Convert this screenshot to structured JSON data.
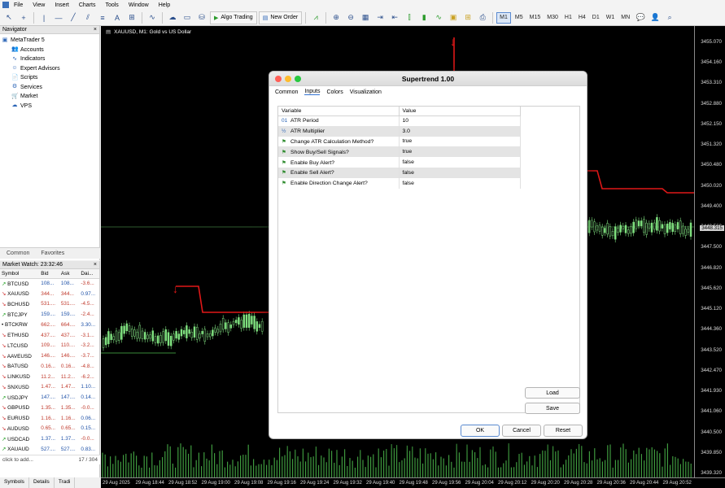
{
  "menu": [
    "File",
    "View",
    "Insert",
    "Charts",
    "Tools",
    "Window",
    "Help"
  ],
  "toolbar": {
    "algo_trading": "Algo Trading",
    "new_order": "New Order",
    "timeframes": [
      "M1",
      "M5",
      "M15",
      "M30",
      "H1",
      "H4",
      "D1",
      "W1",
      "MN"
    ],
    "active_timeframe": "M1"
  },
  "navigator": {
    "title": "Navigator",
    "root": "MetaTrader 5",
    "items": [
      "Accounts",
      "Indicators",
      "Expert Advisors",
      "Scripts",
      "Services",
      "Market",
      "VPS"
    ],
    "tabs": [
      "Common",
      "Favorites"
    ]
  },
  "market_watch": {
    "title": "Market Watch: 23:32:46",
    "columns": [
      "Symbol",
      "Bid",
      "Ask",
      "Dai..."
    ],
    "rows": [
      {
        "symbol": "BTCUSD",
        "bid": "108...",
        "ask": "108...",
        "daily": "-3.6...",
        "dir": "up"
      },
      {
        "symbol": "XAUUSD",
        "bid": "344...",
        "ask": "344...",
        "daily": "0.97...",
        "dir": "dn"
      },
      {
        "symbol": "BCHUSD",
        "bid": "531....",
        "ask": "531....",
        "daily": "-4.5...",
        "dir": "dn"
      },
      {
        "symbol": "BTCJPY",
        "bid": "159....",
        "ask": "159....",
        "daily": "-2.4...",
        "dir": "up"
      },
      {
        "symbol": "BTCKRW",
        "bid": "662....",
        "ask": "664....",
        "daily": "3.30...",
        "dir": "flat"
      },
      {
        "symbol": "ETHUSD",
        "bid": "437....",
        "ask": "437....",
        "daily": "-3.1...",
        "dir": "dn"
      },
      {
        "symbol": "LTCUSD",
        "bid": "109....",
        "ask": "110....",
        "daily": "-3.2...",
        "dir": "dn"
      },
      {
        "symbol": "AAVEUSD",
        "bid": "146....",
        "ask": "146....",
        "daily": "-3.7...",
        "dir": "dn"
      },
      {
        "symbol": "BATUSD",
        "bid": "0.16...",
        "ask": "0.16...",
        "daily": "-4.8...",
        "dir": "dn"
      },
      {
        "symbol": "LINKUSD",
        "bid": "11.2...",
        "ask": "11.2...",
        "daily": "-6.2...",
        "dir": "dn"
      },
      {
        "symbol": "SNXUSD",
        "bid": "1.47...",
        "ask": "1.47...",
        "daily": "1.10...",
        "dir": "dn"
      },
      {
        "symbol": "USDJPY",
        "bid": "147....",
        "ask": "147....",
        "daily": "0.14...",
        "dir": "up"
      },
      {
        "symbol": "GBPUSD",
        "bid": "1.35...",
        "ask": "1.35...",
        "daily": "-0.0...",
        "dir": "dn"
      },
      {
        "symbol": "EURUSD",
        "bid": "1.16...",
        "ask": "1.16...",
        "daily": "0.06...",
        "dir": "dn"
      },
      {
        "symbol": "AUDUSD",
        "bid": "0.65...",
        "ask": "0.65...",
        "daily": "0.15...",
        "dir": "dn"
      },
      {
        "symbol": "USDCAD",
        "bid": "1.37...",
        "ask": "1.37...",
        "daily": "-0.0...",
        "dir": "up"
      },
      {
        "symbol": "XAUAUD",
        "bid": "527....",
        "ask": "527....",
        "daily": "0.83...",
        "dir": "up"
      }
    ],
    "add_hint": "click to add...",
    "count": "17 / 304"
  },
  "bottom_tabs": [
    "Symbols",
    "Details",
    "Tradi"
  ],
  "chart": {
    "title": "XAUUSD, M1: Gold vs US Dollar",
    "current_price": "3448.315",
    "price_labels": [
      "3455.070",
      "3454.160",
      "3453.310",
      "3452.880",
      "3452.150",
      "3451.320",
      "3450.480",
      "3450.020",
      "3449.400",
      "3448.560",
      "3447.500",
      "3446.820",
      "3445.620",
      "3445.120",
      "3444.360",
      "3443.520",
      "3442.470",
      "3441.930",
      "3441.060",
      "3440.500",
      "3439.850",
      "3439.320"
    ],
    "time_labels": [
      "29 Aug 2025",
      "29 Aug 18:44",
      "29 Aug 18:52",
      "29 Aug 19:00",
      "29 Aug 19:08",
      "29 Aug 19:16",
      "29 Aug 19:24",
      "29 Aug 19:32",
      "29 Aug 19:40",
      "29 Aug 19:48",
      "29 Aug 19:56",
      "29 Aug 20:04",
      "29 Aug 20:12",
      "29 Aug 20:20",
      "29 Aug 20:28",
      "29 Aug 20:36",
      "29 Aug 20:44",
      "29 Aug 20:52"
    ]
  },
  "dialog": {
    "title": "Supertrend 1.00",
    "tabs": [
      "Common",
      "Inputs",
      "Colors",
      "Visualization"
    ],
    "active_tab": "Inputs",
    "columns": [
      "Variable",
      "Value"
    ],
    "params": [
      {
        "icon": "01",
        "name": "ATR Period",
        "value": "10"
      },
      {
        "icon": "½",
        "name": "ATR Multiplier",
        "value": "3.0"
      },
      {
        "icon": "flag",
        "name": "Change ATR Calculation Method?",
        "value": "true"
      },
      {
        "icon": "flag",
        "name": "Show Buy/Sell Signals?",
        "value": "true"
      },
      {
        "icon": "flag",
        "name": "Enable Buy Alert?",
        "value": "false"
      },
      {
        "icon": "flag",
        "name": "Enable Sell Alert?",
        "value": "false"
      },
      {
        "icon": "flag",
        "name": "Enable Direction Change Alert?",
        "value": "false"
      }
    ],
    "load_label": "Load",
    "save_label": "Save",
    "ok_label": "OK",
    "cancel_label": "Cancel",
    "reset_label": "Reset"
  }
}
